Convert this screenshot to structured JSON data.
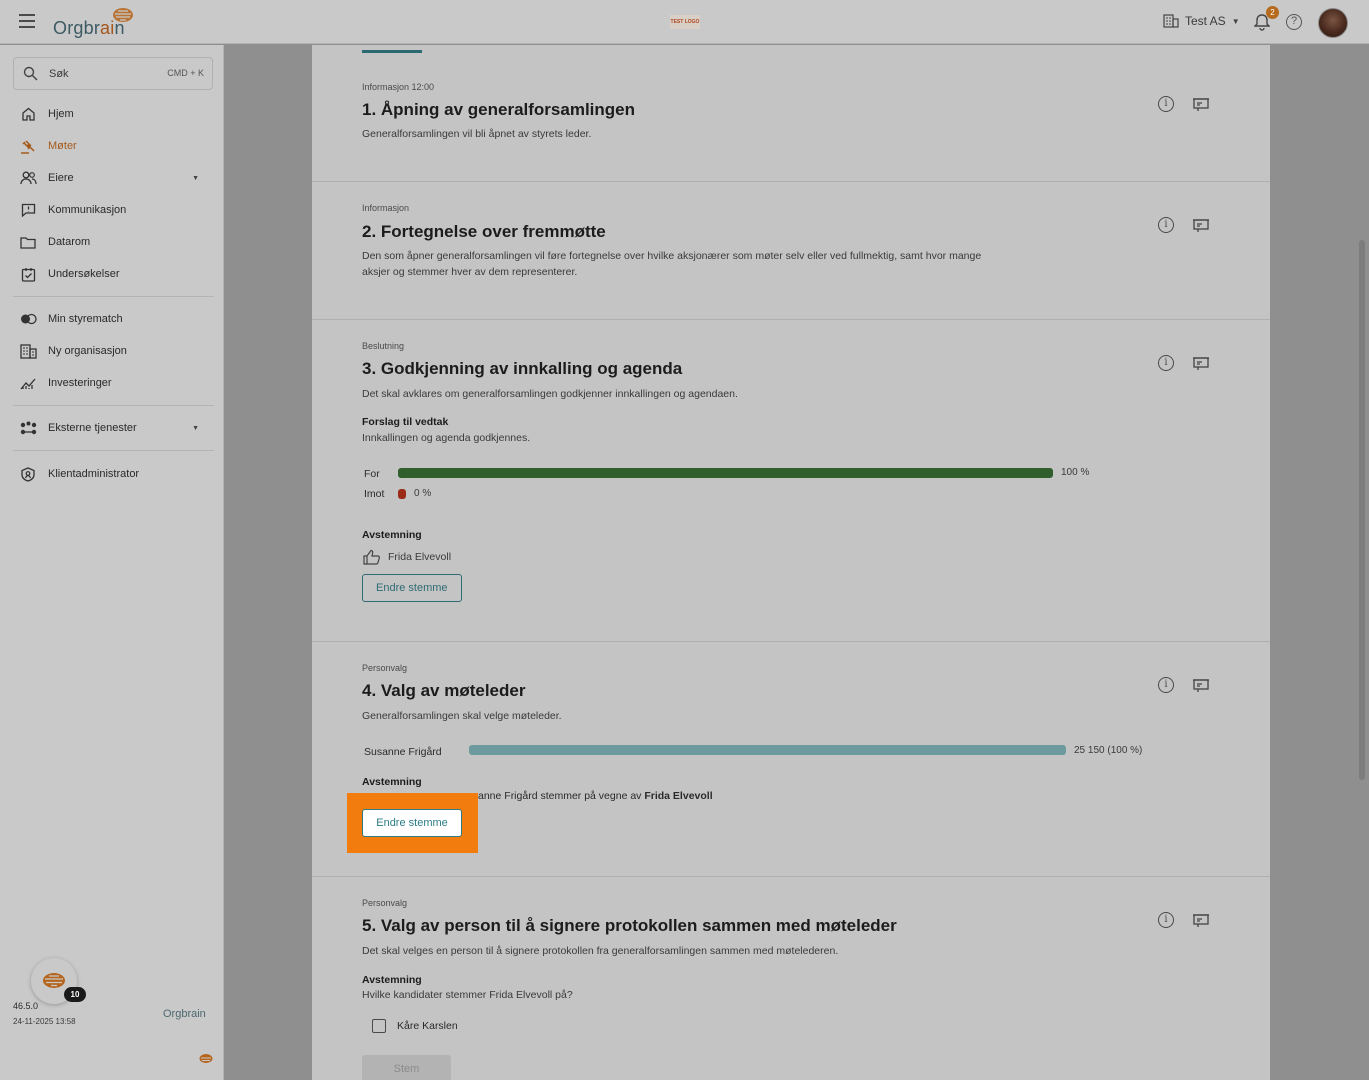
{
  "header": {
    "logo_text_a": "Orgbr",
    "logo_text_b": "ai",
    "logo_text_c": "n",
    "center_logo_text": "TEST LOGO",
    "company_name": "Test AS",
    "notification_count": "2",
    "help_label": "?"
  },
  "sidebar": {
    "search_placeholder": "Søk",
    "search_shortcut": "CMD + K",
    "items": [
      {
        "label": "Hjem",
        "icon": "home-icon"
      },
      {
        "label": "Møter",
        "icon": "gavel-icon",
        "active": true
      },
      {
        "label": "Eiere",
        "icon": "people-icon",
        "expandable": true
      },
      {
        "label": "Kommunikasjon",
        "icon": "message-icon"
      },
      {
        "label": "Datarom",
        "icon": "folder-icon"
      },
      {
        "label": "Undersøkelser",
        "icon": "survey-icon"
      },
      {
        "label": "Min styrematch",
        "icon": "match-icon"
      },
      {
        "label": "Ny organisasjon",
        "icon": "building-icon"
      },
      {
        "label": "Investeringer",
        "icon": "chart-icon"
      },
      {
        "label": "Eksterne tjenester",
        "icon": "services-icon",
        "expandable": true
      },
      {
        "label": "Klientadministrator",
        "icon": "shield-icon"
      }
    ],
    "version_badge": "10",
    "version": "46.5.0",
    "build_date": "24-11-2025 13:58",
    "footer_logo": "Orgbrain"
  },
  "agenda": [
    {
      "category": "Informasjon 12:00",
      "title": "1. Åpning av generalforsamlingen",
      "description": "Generalforsamlingen vil bli åpnet av styrets leder."
    },
    {
      "category": "Informasjon",
      "title": "2. Fortegnelse over fremmøtte",
      "description": "Den som åpner generalforsamlingen vil føre fortegnelse over hvilke aksjonærer som møter selv eller ved fullmektig, samt hvor mange aksjer og stemmer hver av dem representerer."
    },
    {
      "category": "Beslutning",
      "title": "3. Godkjenning av innkalling og agenda",
      "description": "Det skal avklares om generalforsamlingen godkjenner innkallingen og agendaen.",
      "proposal_label": "Forslag til vedtak",
      "proposal_text": "Innkallingen og agenda godkjennes.",
      "for_label": "For",
      "for_value": "100 %",
      "for_fraction": 1.0,
      "against_label": "Imot",
      "against_value": "0 %",
      "against_fraction": 0.0,
      "voting_label": "Avstemning",
      "voter": "Frida Elvevoll",
      "change_vote_label": "Endre stemme"
    },
    {
      "category": "Personvalg",
      "title": "4. Valg av møteleder",
      "description": "Generalforsamlingen skal velge møteleder.",
      "candidate": "Susanne Frigård",
      "candidate_value": "25 150 (100 %)",
      "candidate_fraction": 1.0,
      "voting_label": "Avstemning",
      "proxy_text": "anne Frigård stemmer på vegne av ",
      "proxy_name": "Frida Elvevoll",
      "change_vote_label": "Endre stemme"
    },
    {
      "category": "Personvalg",
      "title": "5. Valg av person til å signere protokollen sammen med møteleder",
      "description": "Det skal velges en person til å signere protokollen fra generalforsamlingen sammen med møtelederen.",
      "voting_label": "Avstemning",
      "question": "Hvilke kandidater stemmer Frida Elvevoll på?",
      "option": "Kåre Karslen",
      "submit_label": "Stem"
    }
  ],
  "colors": {
    "accent": "#2b6a72",
    "active_nav": "#a55a1b",
    "for_bar": "#2f5f2c",
    "against_bar": "#9b2b16",
    "candidate_bar": "#6d9a9e",
    "highlight": "#f27c0d"
  }
}
